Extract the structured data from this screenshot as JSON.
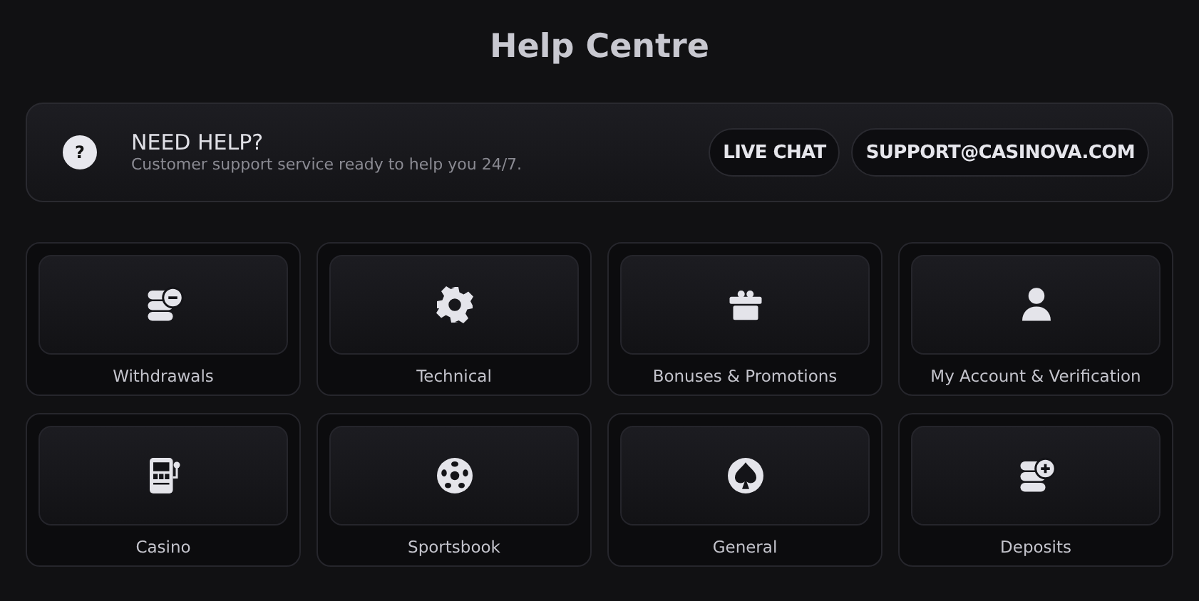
{
  "title": "Help Centre",
  "help_banner": {
    "heading": "NEED HELP?",
    "subtitle": "Customer support service ready to help you 24/7.",
    "icon": "?",
    "buttons": [
      "LIVE CHAT",
      "SUPPORT@CASINOVA.COM"
    ]
  },
  "categories": [
    {
      "label": "Withdrawals",
      "kind": "coins-minus"
    },
    {
      "label": "Technical",
      "kind": "gear"
    },
    {
      "label": "Bonuses & Promotions",
      "kind": "gift"
    },
    {
      "label": "My Account & Verification",
      "kind": "person"
    },
    {
      "label": "Casino",
      "kind": "slot"
    },
    {
      "label": "Sportsbook",
      "kind": "ball"
    },
    {
      "label": "General",
      "kind": "spade"
    },
    {
      "label": "Deposits",
      "kind": "coins-plus"
    }
  ]
}
